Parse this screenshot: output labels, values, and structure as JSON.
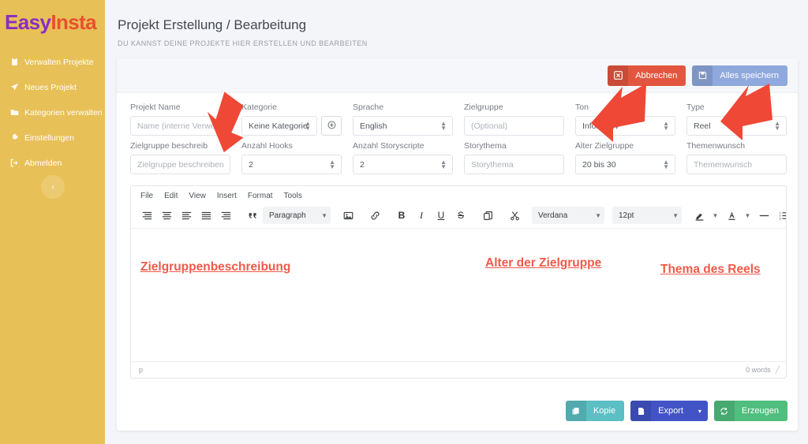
{
  "brand": {
    "part1": "Easy",
    "part2": "Insta",
    "color1": "#8a2ec0",
    "color2": "#e8502e"
  },
  "sidebar": {
    "bg": "#e8c058",
    "items": [
      {
        "label": "Verwalten Projekte",
        "icon": "clipboard-icon"
      },
      {
        "label": "Neues Projekt",
        "icon": "rocket-icon"
      },
      {
        "label": "Kategorien verwalten",
        "icon": "folder-icon"
      },
      {
        "label": "Einstellungen",
        "icon": "gear-icon"
      },
      {
        "label": "Abmelden",
        "icon": "logout-icon"
      }
    ],
    "collapse_glyph": "‹"
  },
  "header": {
    "title": "Projekt Erstellung / Bearbeitung",
    "subtitle": "DU KANNST DEINE PROJEKTE HIER ERSTELLEN UND BEARBEITEN"
  },
  "toolbar_top": {
    "cancel_label": "Abbrechen",
    "cancel_color": "#e2563f",
    "save_label": "Alles speichern",
    "save_color": "#8fa8dd"
  },
  "form": {
    "row1": [
      {
        "label": "Projekt Name",
        "value": "Name (interne Verwendun",
        "type": "text",
        "placeholder": true
      },
      {
        "label": "Kategorie",
        "value": "Keine Kategorie",
        "type": "select",
        "has_add": true
      },
      {
        "label": "Sprache",
        "value": "English",
        "type": "select"
      },
      {
        "label": "Zielgruppe",
        "value": "(Optional)",
        "type": "text",
        "placeholder": true
      },
      {
        "label": "Ton",
        "value": "Informativ",
        "type": "select"
      },
      {
        "label": "Type",
        "value": "Reel",
        "type": "select"
      }
    ],
    "row2": [
      {
        "label": "Zielgruppe beschreib",
        "value": "Zielgruppe beschreiben",
        "type": "text",
        "placeholder": true
      },
      {
        "label": "Anzahl Hooks",
        "value": "2",
        "type": "select"
      },
      {
        "label": "Anzahl Storyscripte",
        "value": "2",
        "type": "select"
      },
      {
        "label": "Storythema",
        "value": "Storythema",
        "type": "text",
        "placeholder": true
      },
      {
        "label": "Alter Zielgruppe",
        "value": "20 bis 30",
        "type": "select"
      },
      {
        "label": "Themenwunsch",
        "value": "Themenwunsch",
        "type": "text",
        "placeholder": true
      }
    ]
  },
  "editor": {
    "menu": [
      "File",
      "Edit",
      "View",
      "Insert",
      "Format",
      "Tools"
    ],
    "block_format": "Paragraph",
    "font_family": "Verdana",
    "font_size": "12pt",
    "overflow_glyph": "•••",
    "content": "",
    "status_path": "p",
    "word_count": "0 words"
  },
  "actions": {
    "kopie_label": "Kopie",
    "kopie_color": "#5bbfc3",
    "export_label": "Export",
    "export_color": "#4254c5",
    "export_caret": "▾",
    "erzeugen_label": "Erzeugen",
    "erzeugen_color": "#4fbe7e"
  },
  "annotations": [
    {
      "text": "Zielgruppenbeschreibung",
      "color": "#f15a4a"
    },
    {
      "text": "Alter der Zielgruppe",
      "color": "#f15a4a"
    },
    {
      "text": "Thema des Reels",
      "color": "#f15a4a"
    }
  ]
}
